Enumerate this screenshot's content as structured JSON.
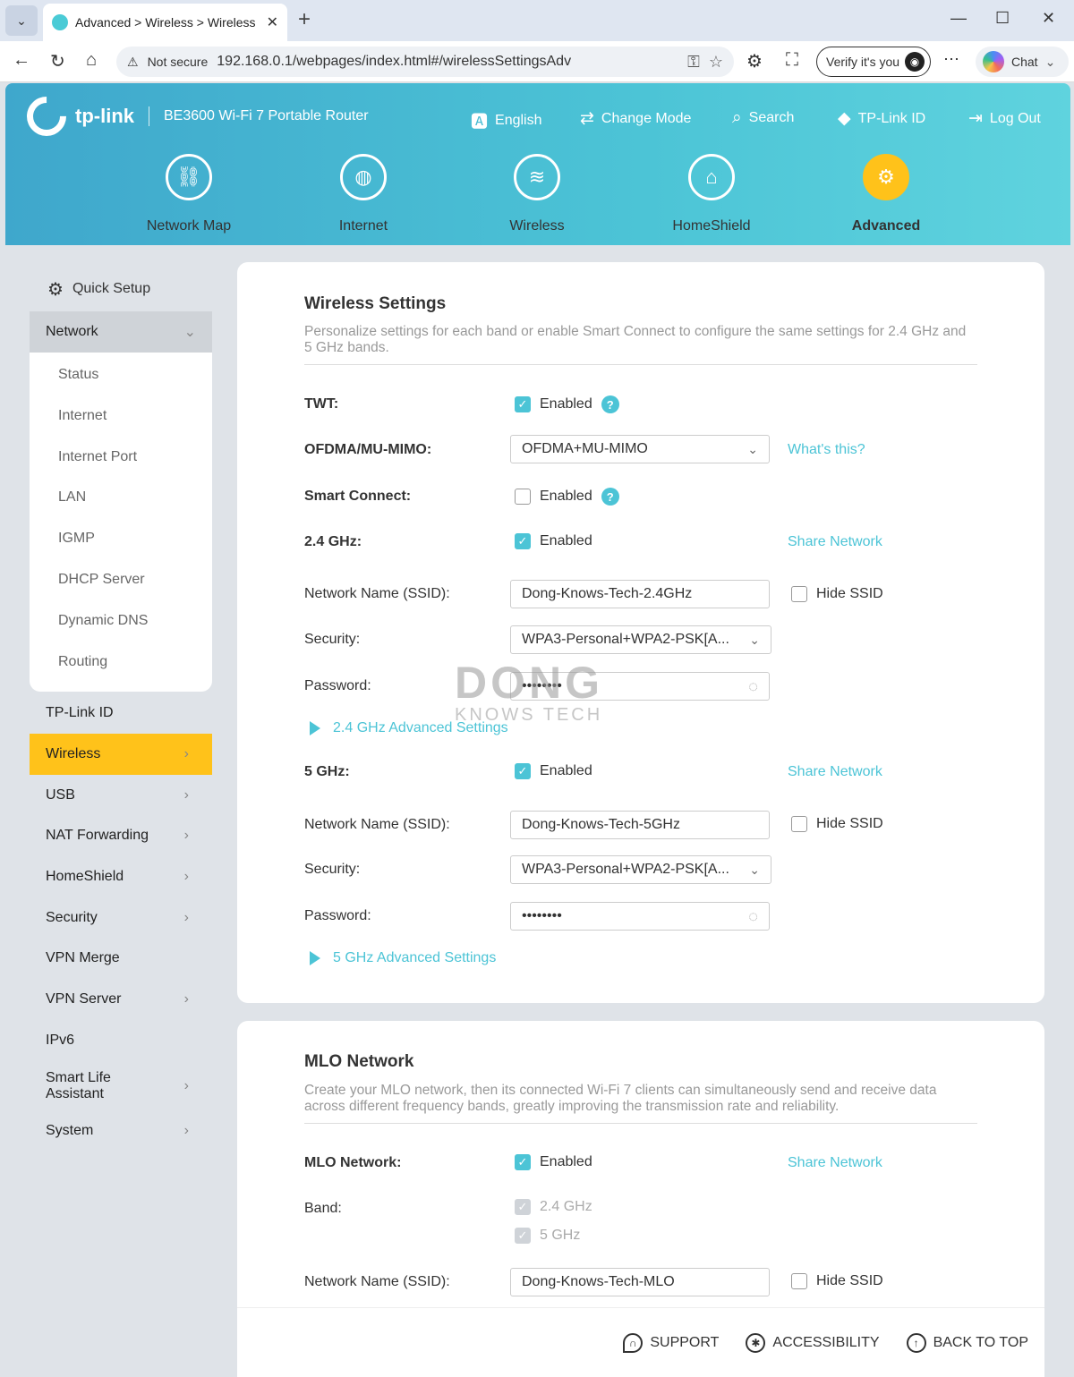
{
  "browser": {
    "tab_title": "Advanced > Wireless > Wireless Se",
    "warning_label": "Not secure",
    "url": "192.168.0.1/webpages/index.html#/wirelessSettingsAdv",
    "verify_label": "Verify it's you",
    "chat_label": "Chat"
  },
  "header": {
    "brand": "tp-link",
    "model": "BE3600 Wi-Fi 7 Portable Router",
    "top_buttons": {
      "language": "English",
      "change_mode": "Change Mode",
      "search": "Search",
      "tplink_id": "TP-Link ID",
      "logout": "Log Out"
    },
    "nav": {
      "network_map": "Network Map",
      "internet": "Internet",
      "wireless": "Wireless",
      "homeshield": "HomeShield",
      "advanced": "Advanced"
    },
    "active_nav": "Advanced",
    "accent_color": "#ffc21a",
    "brand_color": "#4cc4d6"
  },
  "sidebar": {
    "quick_setup": "Quick Setup",
    "network": "Network",
    "network_items": [
      "Status",
      "Internet",
      "Internet Port",
      "LAN",
      "IGMP",
      "DHCP Server",
      "Dynamic DNS",
      "Routing"
    ],
    "items": [
      "TP-Link ID",
      "Wireless",
      "USB",
      "NAT Forwarding",
      "HomeShield",
      "Security",
      "VPN Merge",
      "VPN Server",
      "IPv6",
      "Smart Life Assistant",
      "System"
    ],
    "active": "Wireless"
  },
  "wireless": {
    "title": "Wireless Settings",
    "description": "Personalize settings for each band or enable Smart Connect to configure the same settings for 2.4 GHz and 5 GHz bands.",
    "twt_label": "TWT:",
    "twt_value": "Enabled",
    "ofdma_label": "OFDMA/MU-MIMO:",
    "ofdma_value": "OFDMA+MU-MIMO",
    "whats_this": "What's this?",
    "smart_connect_label": "Smart Connect:",
    "smart_connect_value": "Enabled",
    "band24_label": "2.4 GHz:",
    "band24_value": "Enabled",
    "share_network": "Share Network",
    "ssid_label": "Network Name (SSID):",
    "ssid24": "Dong-Knows-Tech-2.4GHz",
    "hide_ssid": "Hide SSID",
    "security_label": "Security:",
    "security24": "WPA3-Personal+WPA2-PSK[A...",
    "password_label": "Password:",
    "password24": "••••••••",
    "adv24": "2.4 GHz Advanced Settings",
    "band5_label": "5 GHz:",
    "band5_value": "Enabled",
    "ssid5": "Dong-Knows-Tech-5GHz",
    "security5": "WPA3-Personal+WPA2-PSK[A...",
    "password5": "••••••••",
    "adv5": "5 GHz Advanced Settings"
  },
  "watermark": {
    "line1": "DONG",
    "line2": "KNOWS TECH"
  },
  "mlo": {
    "title": "MLO Network",
    "description": "Create your MLO network, then its connected Wi-Fi 7 clients can simultaneously send and receive data across different frequency bands, greatly improving the transmission rate and reliability.",
    "mlo_label": "MLO Network:",
    "mlo_value": "Enabled",
    "share_network": "Share Network",
    "band_label": "Band:",
    "band_24": "2.4 GHz",
    "band_5": "5 GHz",
    "ssid_label": "Network Name (SSID):",
    "ssid": "Dong-Knows-Tech-MLO",
    "hide_ssid": "Hide SSID"
  },
  "footer": {
    "support": "SUPPORT",
    "accessibility": "ACCESSIBILITY",
    "back_to_top": "BACK TO TOP"
  }
}
